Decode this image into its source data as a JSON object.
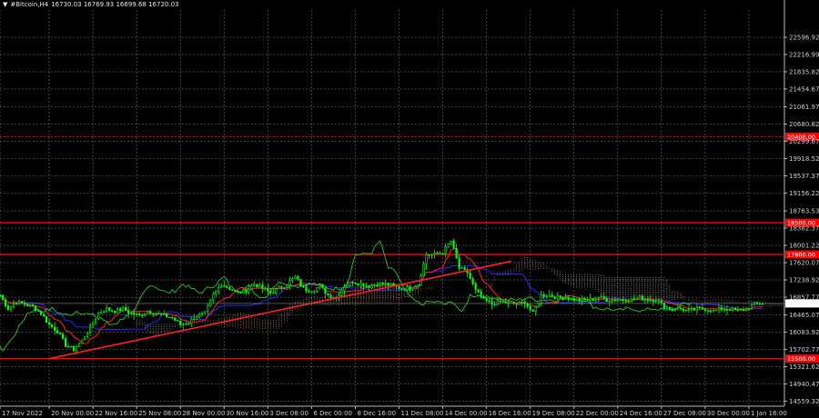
{
  "header": {
    "symbol": "#Bitcoin,H4",
    "ohlc": "16730.03 16769.93 16699.68 16720.03"
  },
  "colors": {
    "background": "#000000",
    "grid": "#6e6e6e",
    "candles": "#00ff00",
    "kumo_senkou_a": "#e3a374",
    "kumo_senkou_b": "#d8d8d8",
    "tenkan": "#ff2222",
    "kijun": "#2a2aff",
    "chikou": "#22cc22",
    "level": "#ff0000",
    "trend": "#ff2222",
    "current_price_label": "#000000"
  },
  "chart_data": {
    "type": "line",
    "title": "",
    "xlabel": "",
    "ylabel": "",
    "ylim": [
      14450,
      23200
    ],
    "xlim": [
      "2022-11-17 00:00",
      "2023-01-03 20:00"
    ],
    "grid": true,
    "y_ticks": [
      "22596.92",
      "22216.99",
      "21835.82",
      "21454.67",
      "21061.97",
      "20680.82",
      "20299.67",
      "19918.52",
      "19537.37",
      "19156.22",
      "18763.53",
      "18382.37",
      "18001.22",
      "17620.07",
      "17238.92",
      "16857.77",
      "16465.07",
      "16083.92",
      "15702.77",
      "15321.62",
      "14940.47",
      "14559.32"
    ],
    "x_ticks": [
      "17 Nov 2022",
      "20 Nov 00:00",
      "22 Nov 16:00",
      "25 Nov 08:00",
      "28 Nov 00:00",
      "30 Nov 16:00",
      "3 Dec 08:00",
      "6 Dec 00:00",
      "8 Dec 16:00",
      "11 Dec 08:00",
      "14 Dec 00:00",
      "16 Dec 16:00",
      "19 Dec 08:00",
      "22 Dec 00:00",
      "24 Dec 16:00",
      "27 Dec 08:00",
      "30 Dec 00:00",
      "1 Jan 16:00"
    ],
    "levels": [
      {
        "value": 20400,
        "label": "20400.00",
        "style": "dotted"
      },
      {
        "value": 18500,
        "label": "18500.00",
        "style": "solid"
      },
      {
        "value": 17800,
        "label": "17800.00",
        "style": "solid"
      },
      {
        "value": 15500,
        "label": "15500.00",
        "style": "solid"
      }
    ],
    "current_price": {
      "value": 16720.03,
      "label": "16720.03"
    },
    "trendline": {
      "x": [
        "2022-11-20 00:00",
        "2022-12-18 04:00"
      ],
      "y": [
        15500,
        17650
      ]
    },
    "series": [
      {
        "values": [
          [
            "2022-11-17 00:00",
            16900
          ],
          [
            "2022-11-17 12:00",
            16600
          ],
          [
            "2022-11-18 00:00",
            16750
          ],
          [
            "2022-11-18 12:00",
            16700
          ],
          [
            "2022-11-19 00:00",
            16650
          ],
          [
            "2022-11-19 12:00",
            16500
          ],
          [
            "2022-11-20 00:00",
            16250
          ],
          [
            "2022-11-20 12:00",
            16100
          ],
          [
            "2022-11-21 00:00",
            15800
          ],
          [
            "2022-11-21 12:00",
            15700
          ],
          [
            "2022-11-22 00:00",
            15900
          ],
          [
            "2022-11-22 12:00",
            16200
          ],
          [
            "2022-11-23 00:00",
            16500
          ],
          [
            "2022-11-23 12:00",
            16600
          ],
          [
            "2022-11-24 00:00",
            16550
          ],
          [
            "2022-11-24 12:00",
            16600
          ],
          [
            "2022-11-25 00:00",
            16500
          ],
          [
            "2022-11-25 12:00",
            16450
          ],
          [
            "2022-11-26 00:00",
            16550
          ],
          [
            "2022-11-26 12:00",
            16500
          ],
          [
            "2022-11-27 00:00",
            16450
          ],
          [
            "2022-11-27 12:00",
            16400
          ],
          [
            "2022-11-28 00:00",
            16250
          ],
          [
            "2022-11-28 12:00",
            16300
          ],
          [
            "2022-11-29 00:00",
            16450
          ],
          [
            "2022-11-29 12:00",
            16500
          ],
          [
            "2022-11-30 00:00",
            16900
          ],
          [
            "2022-11-30 12:00",
            17150
          ],
          [
            "2022-12-01 00:00",
            17050
          ],
          [
            "2022-12-01 12:00",
            16950
          ],
          [
            "2022-12-02 00:00",
            17000
          ],
          [
            "2022-12-02 12:00",
            17150
          ],
          [
            "2022-12-03 00:00",
            17050
          ],
          [
            "2022-12-03 12:00",
            16950
          ],
          [
            "2022-12-04 00:00",
            17050
          ],
          [
            "2022-12-04 12:00",
            17150
          ],
          [
            "2022-12-05 00:00",
            17300
          ],
          [
            "2022-12-05 12:00",
            17050
          ],
          [
            "2022-12-06 00:00",
            17000
          ],
          [
            "2022-12-06 12:00",
            17100
          ],
          [
            "2022-12-07 00:00",
            16900
          ],
          [
            "2022-12-07 12:00",
            16850
          ],
          [
            "2022-12-08 00:00",
            17100
          ],
          [
            "2022-12-08 12:00",
            17200
          ],
          [
            "2022-12-09 00:00",
            17150
          ],
          [
            "2022-12-09 12:00",
            17100
          ],
          [
            "2022-12-10 00:00",
            17150
          ],
          [
            "2022-12-10 12:00",
            17150
          ],
          [
            "2022-12-11 00:00",
            17100
          ],
          [
            "2022-12-11 12:00",
            17050
          ],
          [
            "2022-12-12 00:00",
            17050
          ],
          [
            "2022-12-12 12:00",
            17150
          ],
          [
            "2022-12-13 00:00",
            17800
          ],
          [
            "2022-12-13 12:00",
            17800
          ],
          [
            "2022-12-14 00:00",
            17850
          ],
          [
            "2022-12-14 12:00",
            18100
          ],
          [
            "2022-12-15 00:00",
            17500
          ],
          [
            "2022-12-15 12:00",
            17400
          ],
          [
            "2022-12-16 00:00",
            17000
          ],
          [
            "2022-12-16 12:00",
            16800
          ],
          [
            "2022-12-17 00:00",
            16700
          ],
          [
            "2022-12-17 12:00",
            16750
          ],
          [
            "2022-12-18 00:00",
            16750
          ],
          [
            "2022-12-18 12:00",
            16700
          ],
          [
            "2022-12-19 00:00",
            16750
          ],
          [
            "2022-12-19 12:00",
            16500
          ],
          [
            "2022-12-20 00:00",
            16900
          ],
          [
            "2022-12-20 12:00",
            16900
          ],
          [
            "2022-12-21 00:00",
            16850
          ],
          [
            "2022-12-21 12:00",
            16850
          ],
          [
            "2022-12-22 00:00",
            16800
          ],
          [
            "2022-12-22 12:00",
            16800
          ],
          [
            "2022-12-23 00:00",
            16800
          ],
          [
            "2022-12-23 12:00",
            16850
          ],
          [
            "2022-12-24 00:00",
            16800
          ],
          [
            "2022-12-24 12:00",
            16800
          ],
          [
            "2022-12-25 00:00",
            16800
          ],
          [
            "2022-12-25 12:00",
            16800
          ],
          [
            "2022-12-26 00:00",
            16850
          ],
          [
            "2022-12-26 12:00",
            16800
          ],
          [
            "2022-12-27 00:00",
            16800
          ],
          [
            "2022-12-27 12:00",
            16650
          ],
          [
            "2022-12-28 00:00",
            16600
          ],
          [
            "2022-12-28 12:00",
            16600
          ],
          [
            "2022-12-29 00:00",
            16550
          ],
          [
            "2022-12-29 12:00",
            16600
          ],
          [
            "2022-12-30 00:00",
            16600
          ],
          [
            "2022-12-30 12:00",
            16550
          ],
          [
            "2022-12-31 00:00",
            16600
          ],
          [
            "2022-12-31 12:00",
            16600
          ],
          [
            "2023-01-01 00:00",
            16550
          ],
          [
            "2023-01-01 12:00",
            16600
          ],
          [
            "2023-01-02 00:00",
            16700
          ],
          [
            "2023-01-02 12:00",
            16720
          ]
        ]
      }
    ]
  }
}
